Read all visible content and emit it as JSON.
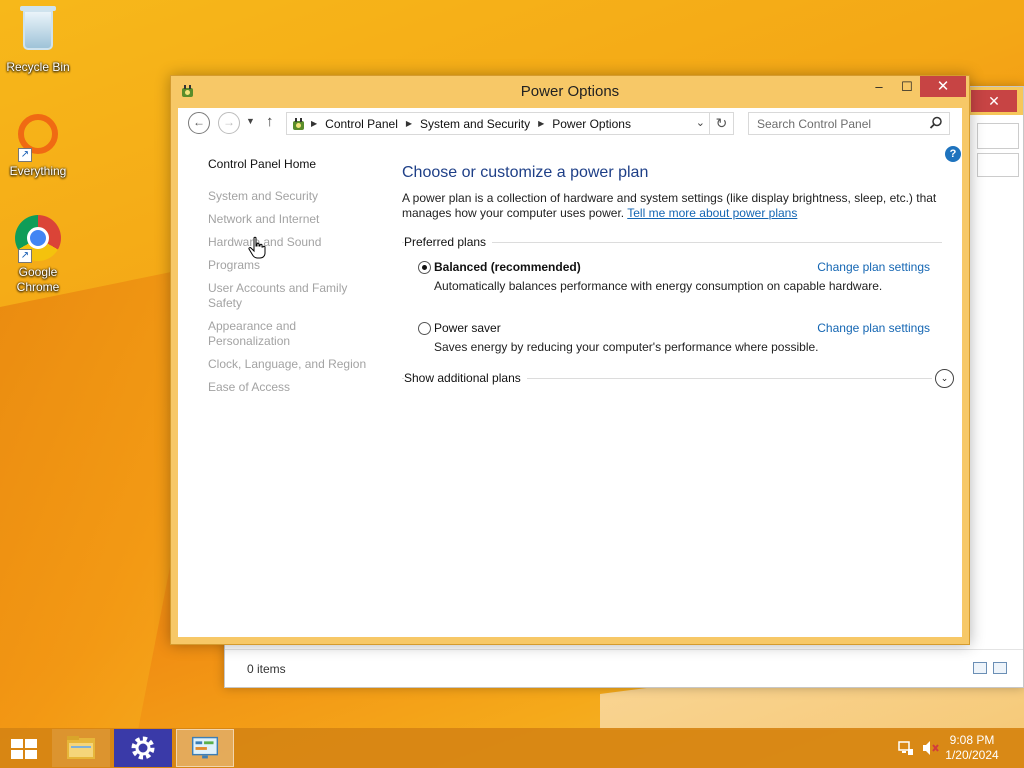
{
  "desktop": {
    "icons": [
      {
        "label": "Recycle Bin"
      },
      {
        "label": "Everything"
      },
      {
        "label": "Google Chrome"
      }
    ]
  },
  "background_window": {
    "close_glyph": "✕",
    "status_text": "0 items"
  },
  "window": {
    "title": "Power Options",
    "controls": {
      "minimize": "–",
      "maximize": "☐",
      "close": "✕"
    },
    "address": {
      "crumbs": [
        "Control Panel",
        "System and Security",
        "Power Options"
      ]
    },
    "search": {
      "placeholder": "Search Control Panel"
    },
    "sidebar": {
      "home": "Control Panel Home",
      "links": [
        "System and Security",
        "Network and Internet",
        "Hardware and Sound",
        "Programs",
        "User Accounts and Family Safety",
        "Appearance and Personalization",
        "Clock, Language, and Region",
        "Ease of Access"
      ]
    },
    "main": {
      "heading": "Choose or customize a power plan",
      "description": "A power plan is a collection of hardware and system settings (like display brightness, sleep, etc.) that manages how your computer uses power.",
      "learn_more": "Tell me more about power plans",
      "preferred_label": "Preferred plans",
      "plans": [
        {
          "name": "Balanced (recommended)",
          "description": "Automatically balances performance with energy consumption on capable hardware.",
          "link": "Change plan settings",
          "selected": true
        },
        {
          "name": "Power saver",
          "description": "Saves energy by reducing your computer's performance where possible.",
          "link": "Change plan settings",
          "selected": false
        }
      ],
      "show_more": "Show additional plans"
    }
  },
  "taskbar": {
    "clock": {
      "time": "9:08 PM",
      "date": "1/20/2024"
    }
  },
  "colors": {
    "accent_link": "#1466b3",
    "heading": "#1e3f87",
    "window_frame": "#f7c867",
    "close_red": "#c74444"
  }
}
